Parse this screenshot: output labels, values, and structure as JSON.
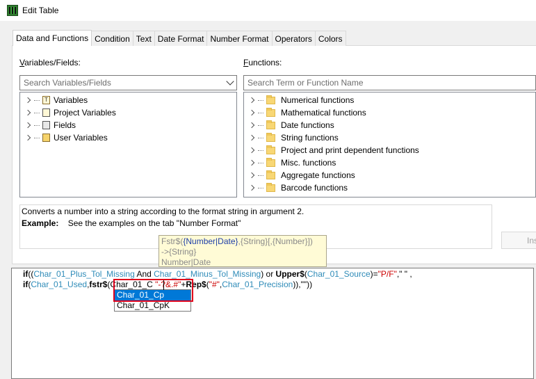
{
  "window": {
    "title": "Edit Table"
  },
  "tabs": [
    "Data and Functions",
    "Condition",
    "Text",
    "Date Format",
    "Number Format",
    "Operators",
    "Colors"
  ],
  "variables": {
    "label_underline": "V",
    "label_rest": "ariables/Fields:",
    "search_placeholder": "Search Variables/Fields",
    "items": [
      {
        "label": "Variables",
        "icon": "text-variable-icon",
        "glyph": "T"
      },
      {
        "label": "Project Variables",
        "icon": "project-variable-icon",
        "glyph": ""
      },
      {
        "label": "Fields",
        "icon": "field-icon",
        "glyph": ""
      },
      {
        "label": "User Variables",
        "icon": "user-variable-icon",
        "glyph": ""
      }
    ]
  },
  "functions": {
    "label_underline": "F",
    "label_rest": "unctions:",
    "search_placeholder": "Search Term or Function Name",
    "items": [
      "Numerical functions",
      "Mathematical functions",
      "Date functions",
      "String functions",
      "Project and print dependent functions",
      "Misc. functions",
      "Aggregate functions",
      "Barcode functions"
    ]
  },
  "description": {
    "text": "Converts a number into a string according to the format string in argument 2.",
    "example_label": "Example:",
    "example_text": "See the examples on the tab \"Number Format\""
  },
  "insert_button": {
    "label": "Ins"
  },
  "tooltip": {
    "sig_fn": "Fstr$(",
    "sig_arg1": "{Number|Date}",
    "sig_rest": ",{String}[,{Number}])",
    "returns": "->{String}",
    "types": "Number|Date"
  },
  "editor": {
    "line1": [
      {
        "t": "if",
        "c": "kw"
      },
      {
        "t": "((",
        "c": "plain"
      },
      {
        "t": "Char_01_Plus_Tol_Missing",
        "c": "fld"
      },
      {
        "t": " And ",
        "c": "plain"
      },
      {
        "t": "Char_01_Minus_Tol_Missing",
        "c": "fld"
      },
      {
        "t": ") or ",
        "c": "plain"
      },
      {
        "t": "Upper$",
        "c": "kw"
      },
      {
        "t": "(",
        "c": "plain"
      },
      {
        "t": "Char_01_Source",
        "c": "fld"
      },
      {
        "t": ")=",
        "c": "plain"
      },
      {
        "t": "\"P/F\"",
        "c": "str"
      },
      {
        "t": ",\" \" ,",
        "c": "plain"
      }
    ],
    "line2": [
      {
        "t": "if",
        "c": "kw"
      },
      {
        "t": "(",
        "c": "plain"
      },
      {
        "t": "Char_01_Used",
        "c": "fld"
      },
      {
        "t": ",",
        "c": "plain"
      },
      {
        "t": "fstr$",
        "c": "kw"
      },
      {
        "t": "(Char_01_C",
        "c": "plain"
      },
      {
        "t": " \"-?&.#\"",
        "c": "str"
      },
      {
        "t": "+",
        "c": "plain"
      },
      {
        "t": "Rep$",
        "c": "kw"
      },
      {
        "t": "(",
        "c": "plain"
      },
      {
        "t": "\"#\"",
        "c": "str"
      },
      {
        "t": ",",
        "c": "plain"
      },
      {
        "t": "Char_01_Precision",
        "c": "fld"
      },
      {
        "t": ")),\"\"))",
        "c": "plain"
      }
    ]
  },
  "autocomplete": [
    "Char_01_Cp",
    "Char_01_CpK"
  ],
  "colors": {
    "accent": "#0078d7",
    "highlight": "#e0001a",
    "field": "#2e8bb8",
    "string": "#cc0000"
  }
}
